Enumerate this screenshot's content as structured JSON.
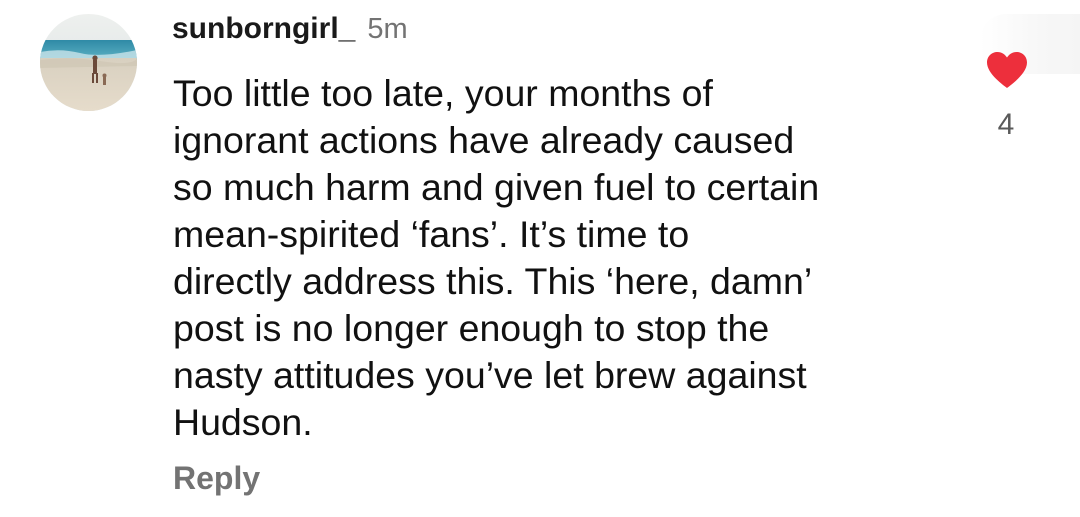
{
  "comment": {
    "username": "sunborngirl_",
    "timestamp": "5m",
    "lines": [
      "Too little too late, your months of",
      "ignorant actions have already caused",
      "so much harm and given fuel to certain",
      "mean-spirited ‘fans’. It’s time to",
      "directly address this. This ‘here, damn’",
      "post is no longer enough to stop the",
      "nasty attitudes you’ve let brew against",
      "Hudson."
    ],
    "like_count": "4",
    "reply_label": "Reply",
    "avatar_icon": "beach-photo-avatar",
    "like_icon": "heart-filled-icon",
    "like_color": "#ed2f3c"
  }
}
